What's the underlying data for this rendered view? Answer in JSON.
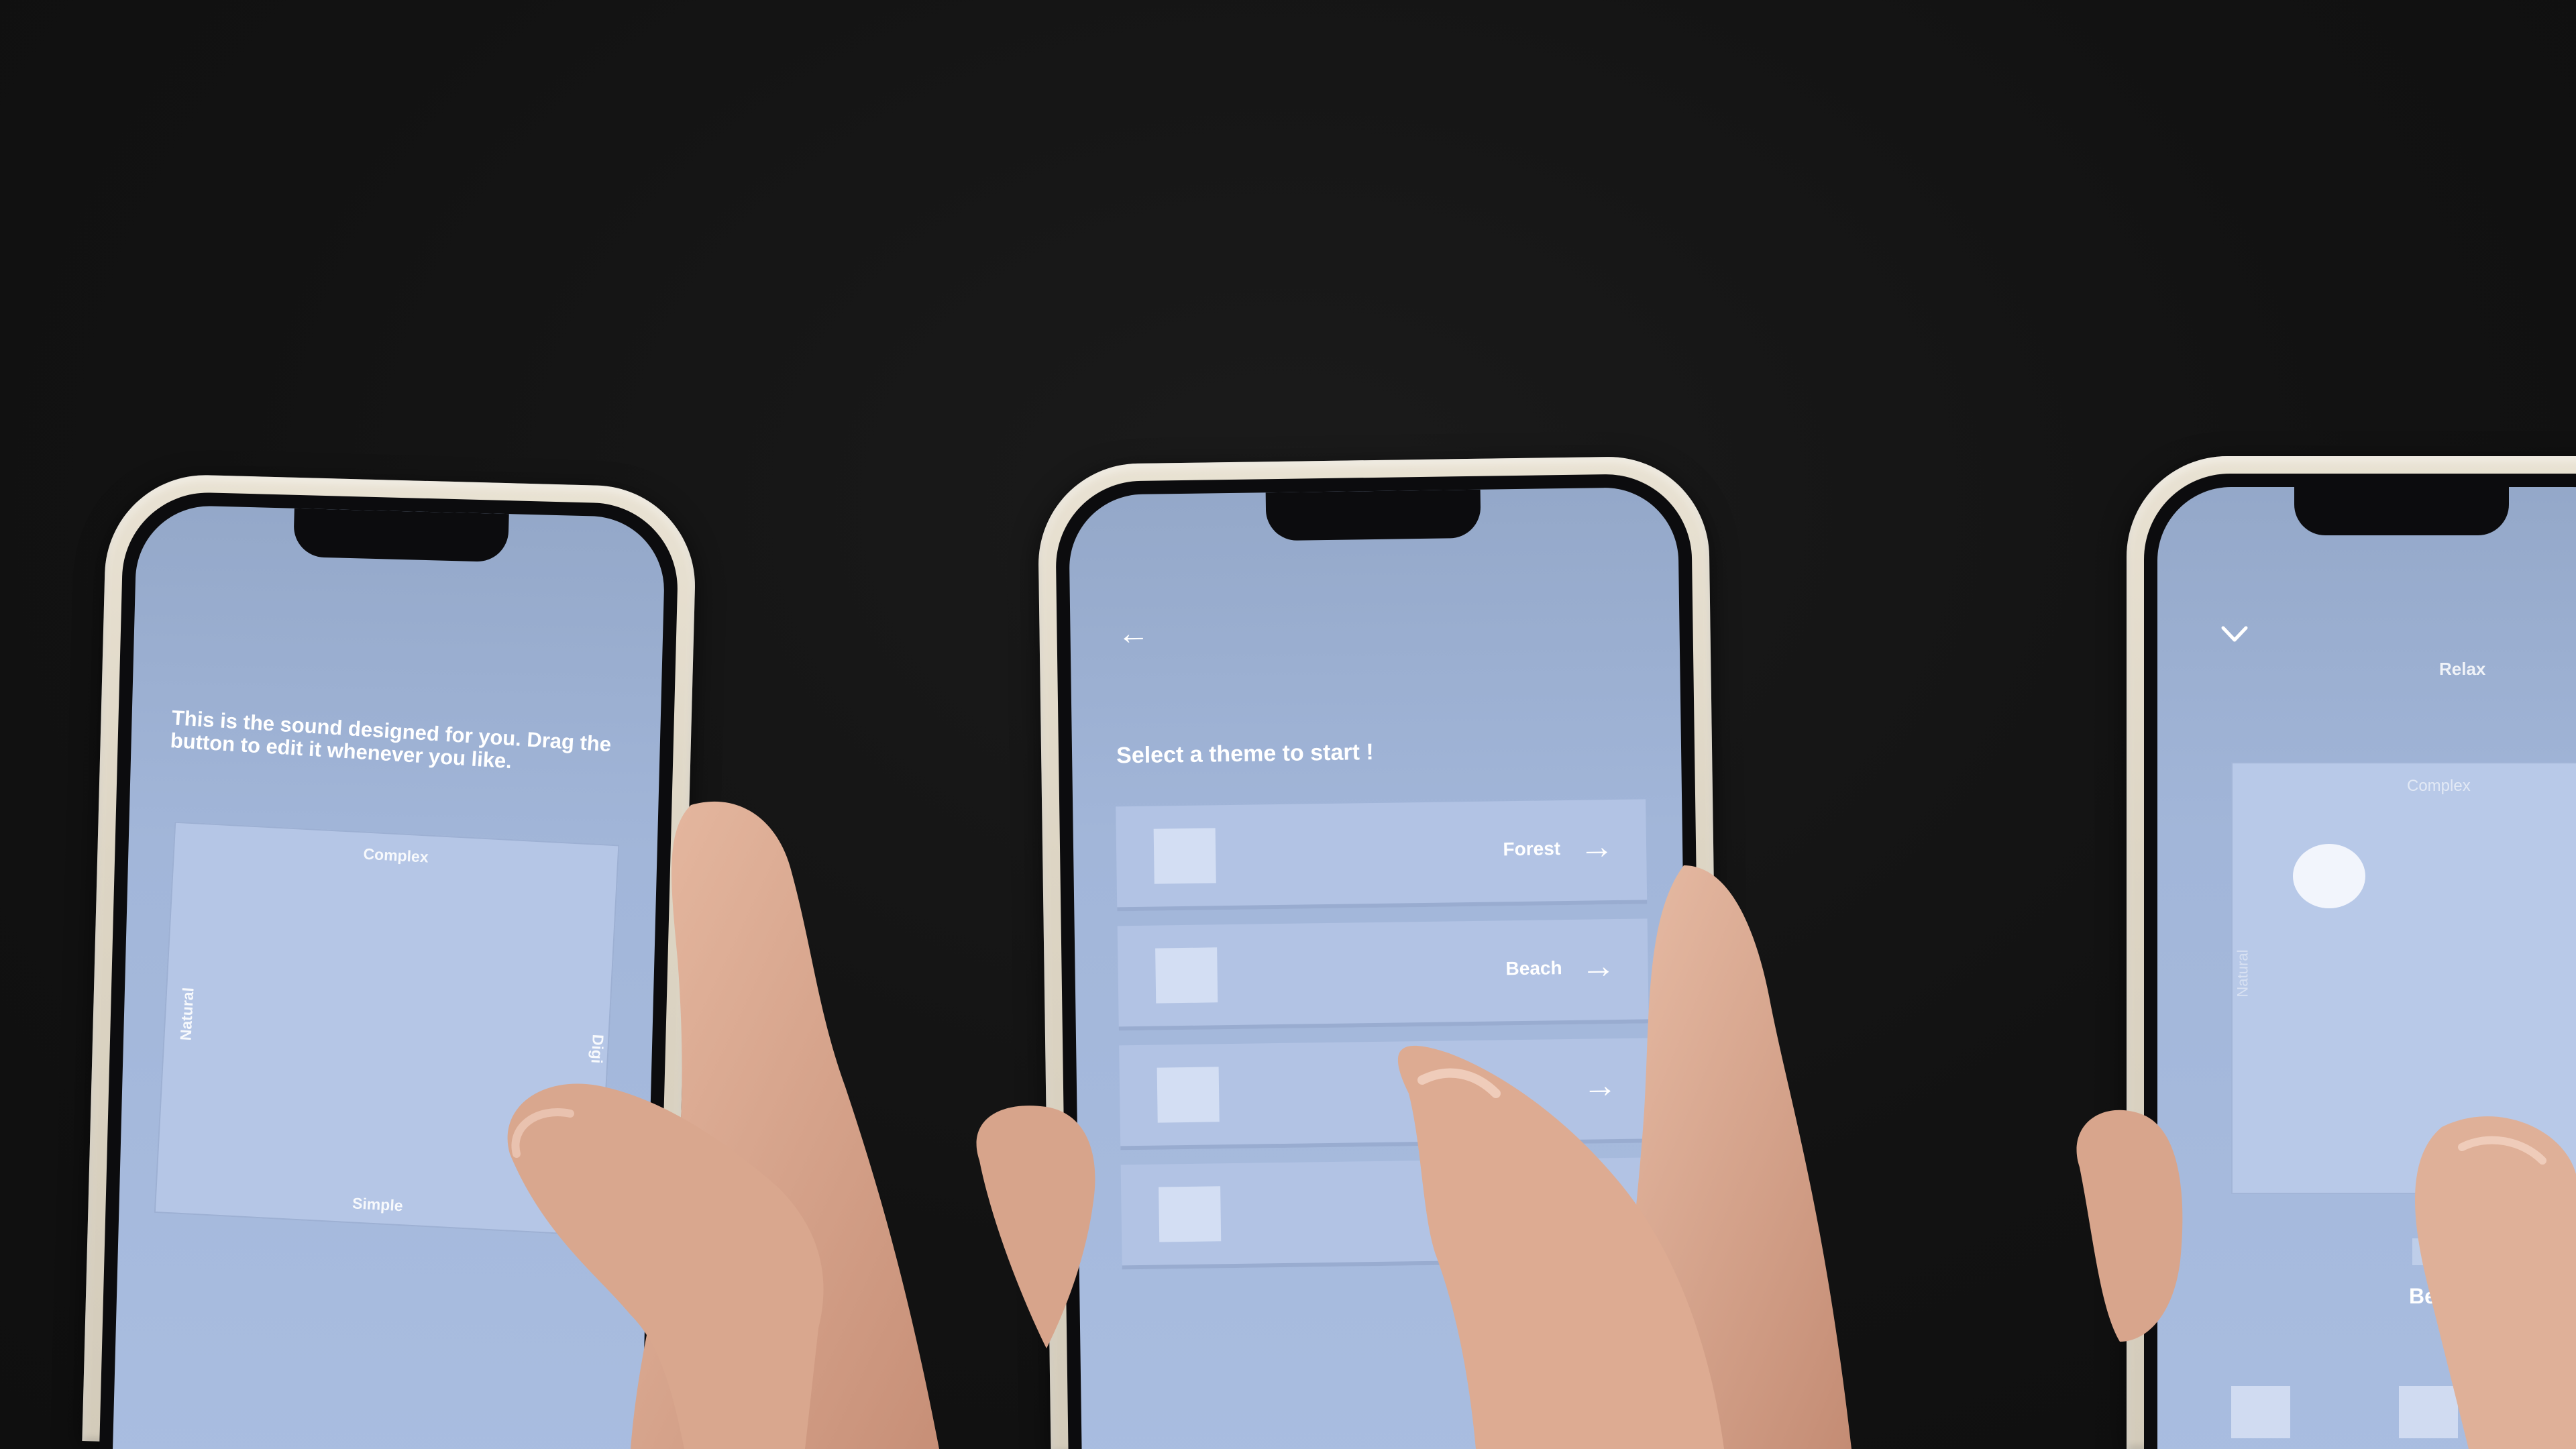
{
  "screen_sound": {
    "description": "This is the sound designed for you. Drag the button to edit it whenever you like.",
    "pad": {
      "top_label": "Complex",
      "bottom_label": "Simple",
      "left_label": "Natural",
      "right_label": "Digi"
    }
  },
  "screen_theme": {
    "back_icon": "arrow-left-icon",
    "title": "Select a theme to start !",
    "themes": [
      {
        "label": "Forest"
      },
      {
        "label": "Beach"
      },
      {
        "label": ""
      },
      {
        "label": ""
      }
    ]
  },
  "screen_relax": {
    "collapse_icon": "chevron-down-icon",
    "title": "Relax",
    "pad": {
      "top_label": "Complex",
      "left_label": "Natural"
    },
    "selected_theme": "Beac"
  },
  "colors": {
    "background": "#131313",
    "screen": "#a2b6d9",
    "phone_case": "#e2dbcb"
  }
}
